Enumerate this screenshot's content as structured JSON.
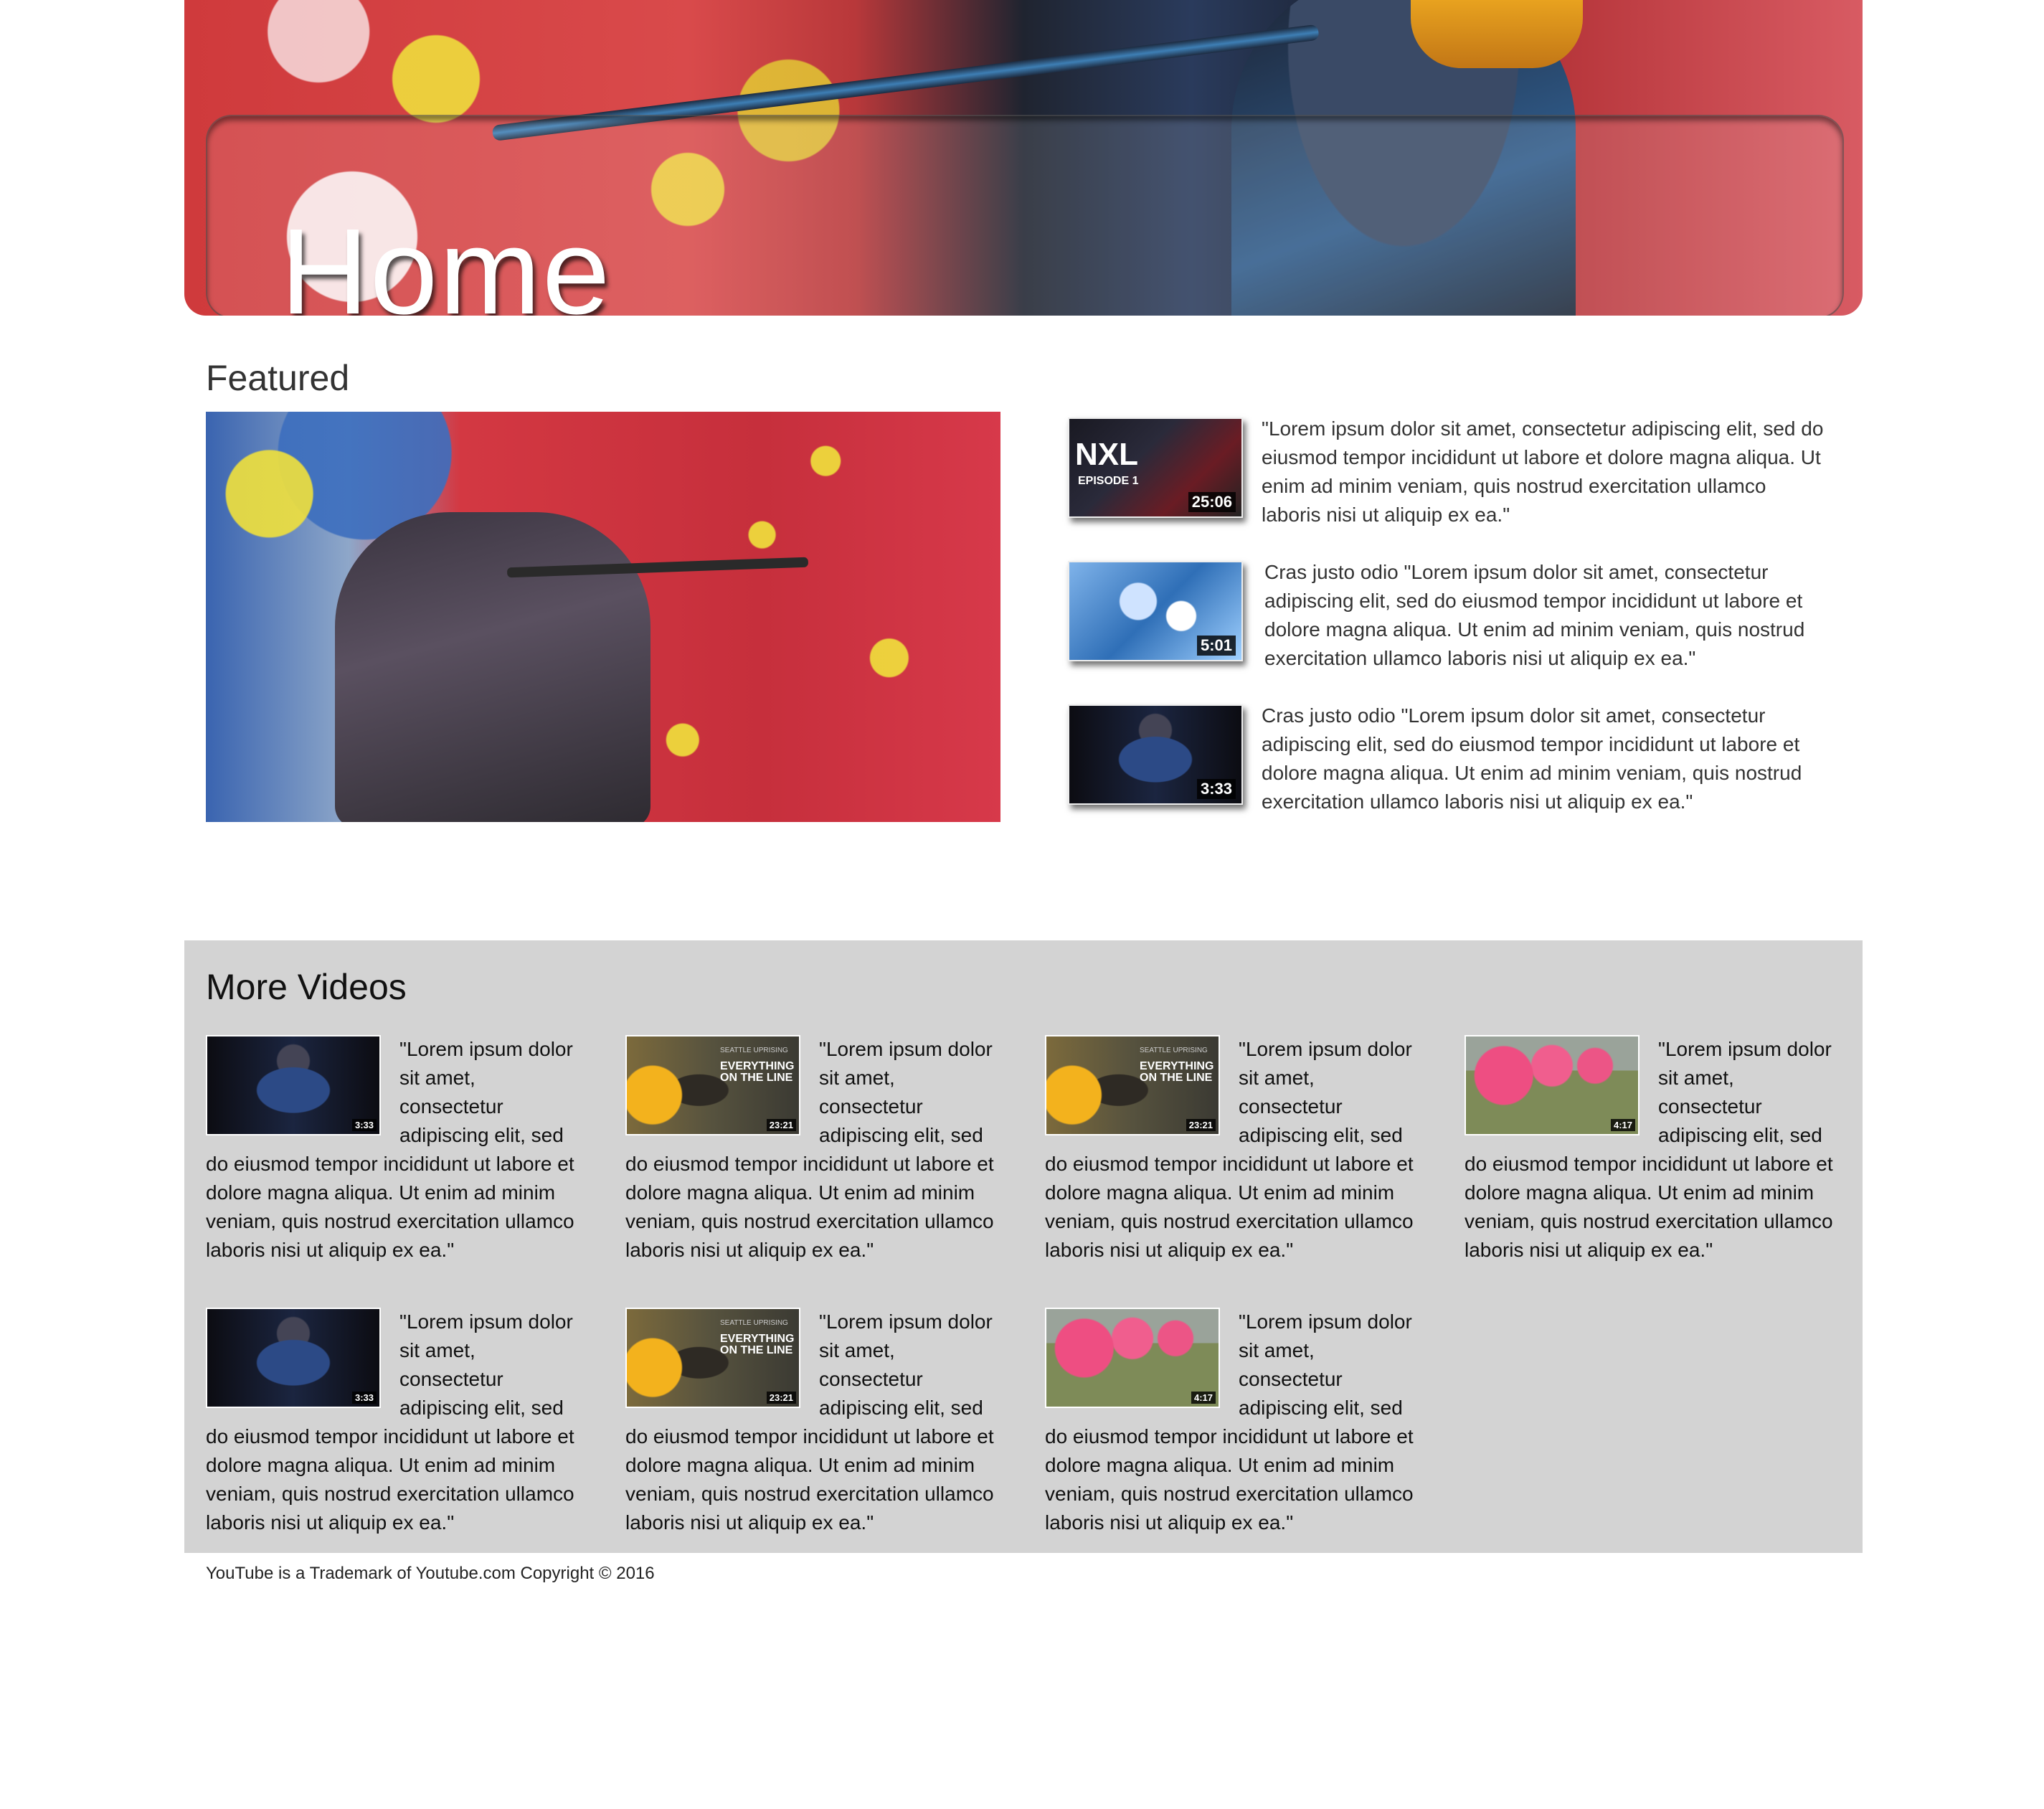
{
  "hero": {
    "title": "Home"
  },
  "featured": {
    "title": "Featured",
    "items": [
      {
        "text": "\"Lorem ipsum dolor sit amet, consectetur adipiscing elit, sed do eiusmod tempor incididunt ut labore et dolore magna aliqua. Ut enim ad minim veniam, quis nostrud exercitation ullamco laboris nisi ut aliquip ex ea.\"",
        "duration": "25:06",
        "thumb_title": "NXL",
        "thumb_subtitle": "EPISODE 1"
      },
      {
        "text": "Cras justo odio \"Lorem ipsum dolor sit amet, consectetur adipiscing elit, sed do eiusmod tempor incididunt ut labore et dolore magna aliqua. Ut enim ad minim veniam, quis nostrud exercitation ullamco laboris nisi ut aliquip ex ea.\"",
        "duration": "5:01"
      },
      {
        "text": "Cras justo odio \"Lorem ipsum dolor sit amet, consectetur adipiscing elit, sed do eiusmod tempor incididunt ut labore et dolore magna aliqua. Ut enim ad minim veniam, quis nostrud exercitation ullamco laboris nisi ut aliquip ex ea.\"",
        "duration": "3:33"
      }
    ]
  },
  "more": {
    "title": "More Videos",
    "items": [
      {
        "text": "\"Lorem ipsum dolor sit amet, consectetur adipiscing elit, sed do eiusmod tempor incididunt ut labore et dolore magna aliqua. Ut enim ad minim veniam, quis nostrud exercitation ullamco laboris nisi ut aliquip ex ea.\"",
        "duration": "3:33"
      },
      {
        "text": "\"Lorem ipsum dolor sit amet, consectetur adipiscing elit, sed do eiusmod tempor incididunt ut labore et dolore magna aliqua. Ut enim ad minim veniam, quis nostrud exercitation ullamco laboris nisi ut aliquip ex ea.\"",
        "duration": "23:21",
        "thumb_caption": "SEATTLE UPRISING",
        "thumb_title": "EVERYTHING ON THE LINE"
      },
      {
        "text": "\"Lorem ipsum dolor sit amet, consectetur adipiscing elit, sed do eiusmod tempor incididunt ut labore et dolore magna aliqua. Ut enim ad minim veniam, quis nostrud exercitation ullamco laboris nisi ut aliquip ex ea.\"",
        "duration": "23:21",
        "thumb_caption": "SEATTLE UPRISING",
        "thumb_title": "EVERYTHING ON THE LINE"
      },
      {
        "text": "\"Lorem ipsum dolor sit amet, consectetur adipiscing elit, sed do eiusmod tempor incididunt ut labore et dolore magna aliqua. Ut enim ad minim veniam, quis nostrud exercitation ullamco laboris nisi ut aliquip ex ea.\"",
        "duration": "4:17"
      },
      {
        "text": "\"Lorem ipsum dolor sit amet, consectetur adipiscing elit, sed do eiusmod tempor incididunt ut labore et dolore magna aliqua. Ut enim ad minim veniam, quis nostrud exercitation ullamco laboris nisi ut aliquip ex ea.\"",
        "duration": "3:33"
      },
      {
        "text": "\"Lorem ipsum dolor sit amet, consectetur adipiscing elit, sed do eiusmod tempor incididunt ut labore et dolore magna aliqua. Ut enim ad minim veniam, quis nostrud exercitation ullamco laboris nisi ut aliquip ex ea.\"",
        "duration": "23:21",
        "thumb_caption": "SEATTLE UPRISING",
        "thumb_title": "EVERYTHING ON THE LINE"
      },
      {
        "text": "\"Lorem ipsum dolor sit amet, consectetur adipiscing elit, sed do eiusmod tempor incididunt ut labore et dolore magna aliqua. Ut enim ad minim veniam, quis nostrud exercitation ullamco laboris nisi ut aliquip ex ea.\"",
        "duration": "4:17"
      }
    ]
  },
  "footer": {
    "text": "YouTube is a Trademark of Youtube.com Copyright © 2016"
  },
  "colors": {
    "more_background": "#d3d3d3",
    "page_background": "#ffffff"
  }
}
